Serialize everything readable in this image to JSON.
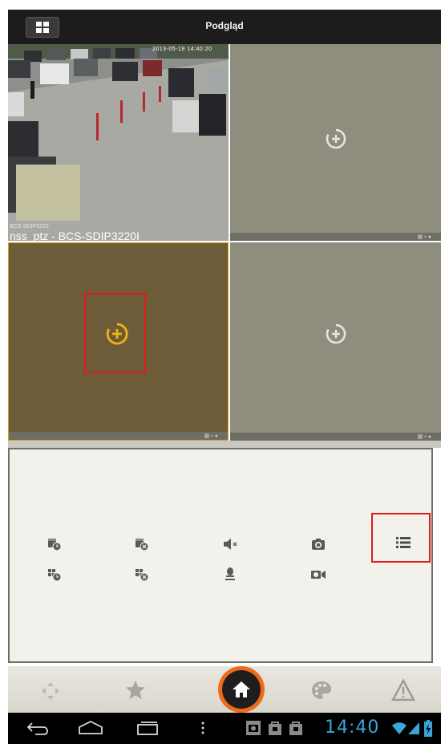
{
  "header": {
    "title": "Podgląd"
  },
  "panes": {
    "pane1": {
      "timestamp": "2013-05-19 14:40:20",
      "osd_label": "BCS-SDIP3220",
      "caption": "nss_ptz - BCS-SDIP3220I"
    }
  },
  "colors": {
    "accent": "#d9a21b",
    "home_ring": "#ef6b1a",
    "highlight_box": "#e01b1b",
    "clock": "#3aa6d8"
  },
  "controls": {
    "row1": [
      "playback-time-icon",
      "close-playback-icon",
      "mute-icon",
      "snapshot-icon",
      "list-icon"
    ],
    "row2": [
      "all-playback-time-icon",
      "close-all-icon",
      "microphone-icon",
      "record-icon"
    ]
  },
  "bottom_nav": [
    "ptz-arrows-icon",
    "favorites-star-icon",
    "home-icon",
    "palette-icon",
    "alarm-warning-icon"
  ],
  "system_bar": {
    "time": "14:40"
  }
}
